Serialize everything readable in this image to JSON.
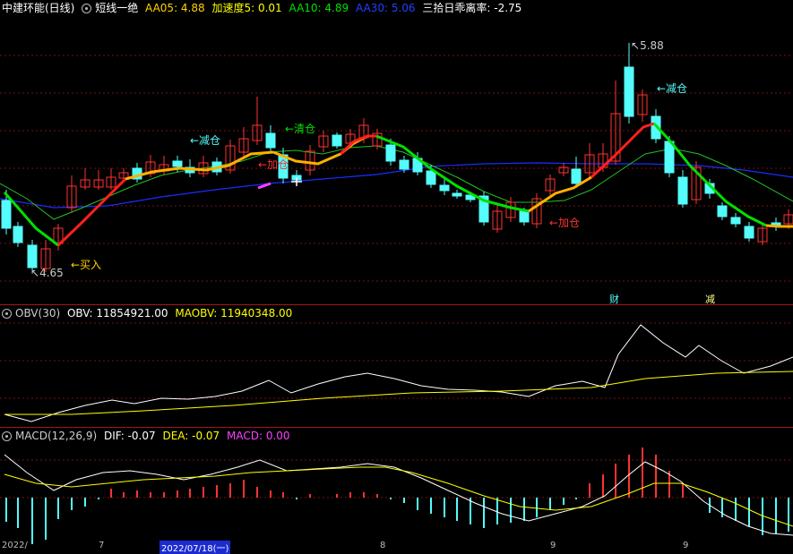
{
  "main": {
    "stock": "中建环能(日线)",
    "indicator_name": "短线一绝",
    "aa05": "AA05: 4.88",
    "accel": "加速度5: 0.01",
    "aa10": "AA10: 4.89",
    "aa30": "AA30: 5.06",
    "bias": "三拾日乖离率: -2.75",
    "high_label": "5.88",
    "low_label": "4.65",
    "signals": {
      "buy": "←买入",
      "reduce1": "←减仓",
      "clear": "←清仓",
      "plus1": "←加仓",
      "plus2": "←加仓",
      "reduce2": "←减仓"
    },
    "tag_cai": "财",
    "tag_jian": "减",
    "colors": {
      "up": "#ff3232",
      "down": "#54fcfc",
      "aa10": "#00d000",
      "aa30": "#1a2cff"
    }
  },
  "obv": {
    "name": "OBV(30)",
    "obv": "OBV: 11854921.00",
    "maobv": "MAOBV: 11940348.00"
  },
  "macd": {
    "name": "MACD(12,26,9)",
    "dif": "DIF: -0.07",
    "dea": "DEA: -0.07",
    "macd": "MACD: 0.00"
  },
  "xaxis": {
    "labels": [
      "2022/",
      "7",
      "2022/07/18(一)",
      "8",
      "9",
      "9"
    ]
  }
}
